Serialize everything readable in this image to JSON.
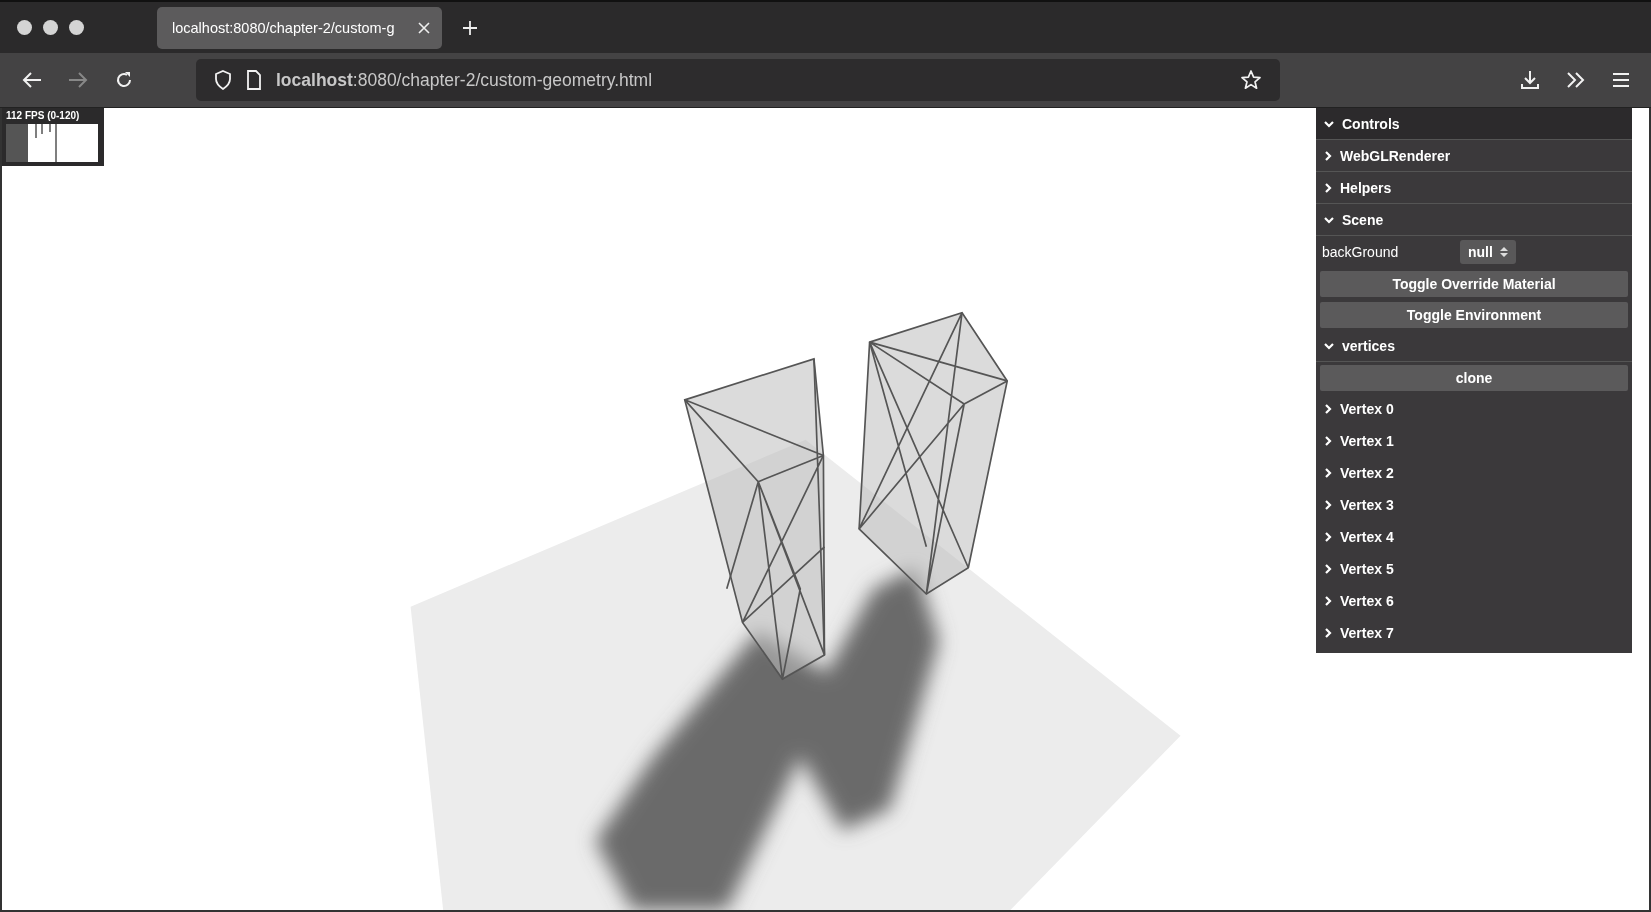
{
  "browser": {
    "tab": {
      "title": "localhost:8080/chapter-2/custom-g",
      "selected": true
    },
    "toolbar": {
      "back_disabled": false,
      "forward_disabled": true,
      "url": "**localhost**:8080/chapter-2/custom-geometry.html"
    }
  },
  "fps": {
    "label": "112 FPS (0-120)"
  },
  "panel": {
    "items": [
      {
        "kind": "folder",
        "label": "Controls",
        "expanded": true,
        "title": true
      },
      {
        "kind": "folder",
        "label": "WebGLRenderer",
        "expanded": false
      },
      {
        "kind": "folder",
        "label": "Helpers",
        "expanded": false
      },
      {
        "kind": "folder",
        "label": "Scene",
        "expanded": true
      },
      {
        "kind": "select",
        "label": "backGround",
        "value": "null"
      },
      {
        "kind": "button",
        "label": "Toggle Override Material"
      },
      {
        "kind": "button",
        "label": "Toggle Environment"
      },
      {
        "kind": "folder",
        "label": "vertices",
        "expanded": true
      },
      {
        "kind": "button",
        "label": "clone"
      },
      {
        "kind": "folder",
        "label": "Vertex 0",
        "expanded": false,
        "plain": true
      },
      {
        "kind": "folder",
        "label": "Vertex 1",
        "expanded": false,
        "plain": true
      },
      {
        "kind": "folder",
        "label": "Vertex 2",
        "expanded": false,
        "plain": true
      },
      {
        "kind": "folder",
        "label": "Vertex 3",
        "expanded": false,
        "plain": true
      },
      {
        "kind": "folder",
        "label": "Vertex 4",
        "expanded": false,
        "plain": true
      },
      {
        "kind": "folder",
        "label": "Vertex 5",
        "expanded": false,
        "plain": true
      },
      {
        "kind": "folder",
        "label": "Vertex 6",
        "expanded": false,
        "plain": true
      },
      {
        "kind": "folder",
        "label": "Vertex 7",
        "expanded": false,
        "plain": true
      }
    ]
  }
}
